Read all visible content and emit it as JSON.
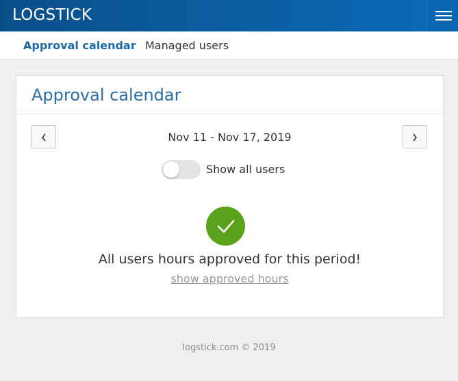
{
  "topbar": {
    "brand": "LOGSTICK",
    "menu_icon": "hamburger-menu-icon",
    "accent": "#0b5fa3"
  },
  "subnav": {
    "items": [
      {
        "label": "Approval calendar",
        "active": true
      },
      {
        "label": "Managed users",
        "active": false
      }
    ],
    "active_color": "#1a6aa8"
  },
  "card": {
    "title": "Approval calendar",
    "prev_icon": "chevron-left-icon",
    "next_icon": "chevron-right-icon",
    "period": "Nov 11 - Nov 17, 2019",
    "toggle": {
      "label": "Show all users",
      "on": false
    },
    "status": {
      "icon": "check-icon",
      "color": "#5aa11c",
      "message": "All users hours approved for this period!",
      "link": "show approved hours"
    }
  },
  "footer": {
    "text": "logstick.com © 2019"
  }
}
